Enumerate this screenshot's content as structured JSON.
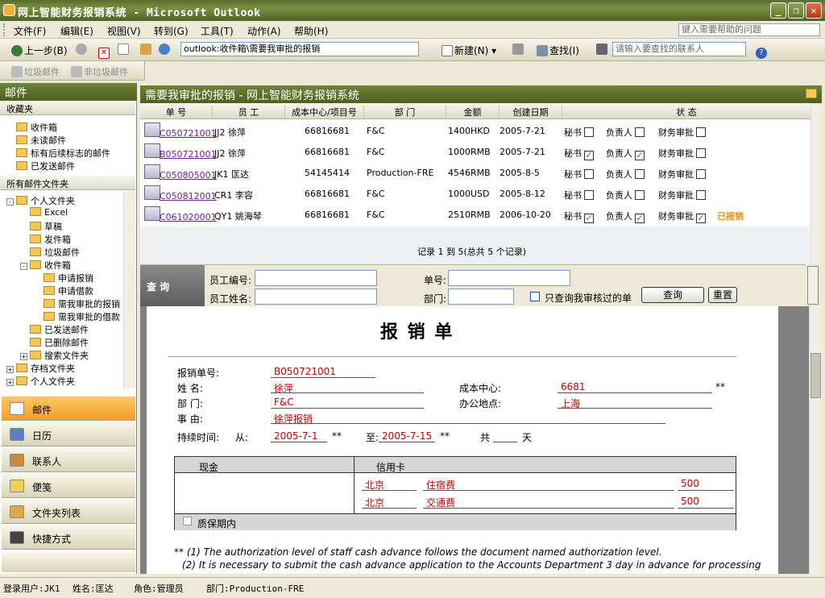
{
  "window": {
    "title": "网上智能财务报销系统 - Microsoft Outlook"
  },
  "menu": [
    "文件(F)",
    "编辑(E)",
    "视图(V)",
    "转到(G)",
    "工具(T)",
    "动作(A)",
    "帮助(H)"
  ],
  "help_placeholder": "键入需要帮助的问题",
  "toolbar": {
    "back": "上一步(B)",
    "address": "outlook:收件箱\\需要我审批的报销",
    "new": "新建(N)",
    "find": "查找(I)",
    "contact_placeholder": "请输入要查找的联系人"
  },
  "junkbar": {
    "junk": "垃圾邮件",
    "notjunk": "非垃圾邮件"
  },
  "left": {
    "header": "邮件",
    "favorites_title": "收藏夹",
    "favorites": [
      "收件箱",
      "未读邮件",
      "标有后续标志的邮件",
      "已发送邮件"
    ],
    "allfolders_title": "所有邮件文件夹",
    "tree": [
      {
        "label": "个人文件夹",
        "indent": 0,
        "exp": "-"
      },
      {
        "label": "Excel",
        "indent": 1
      },
      {
        "label": "草稿",
        "indent": 1
      },
      {
        "label": "发件箱",
        "indent": 1
      },
      {
        "label": "垃圾邮件",
        "indent": 1
      },
      {
        "label": "收件箱",
        "indent": 1,
        "exp": "-"
      },
      {
        "label": "申请报销",
        "indent": 2
      },
      {
        "label": "申请借款",
        "indent": 2
      },
      {
        "label": "需我审批的报销",
        "indent": 2
      },
      {
        "label": "需我审批的借款",
        "indent": 2
      },
      {
        "label": "已发送邮件",
        "indent": 1
      },
      {
        "label": "已删除邮件",
        "indent": 1
      },
      {
        "label": "搜索文件夹",
        "indent": 1,
        "exp": "+"
      },
      {
        "label": "存档文件夹",
        "indent": 0,
        "exp": "+"
      },
      {
        "label": "个人文件夹",
        "indent": 0,
        "exp": "+"
      }
    ],
    "nav": [
      "邮件",
      "日历",
      "联系人",
      "便笺",
      "文件夹列表",
      "快捷方式"
    ]
  },
  "main": {
    "header": "需要我审批的报销 - 网上智能财务报销系统",
    "columns": [
      "单 号",
      "员 工",
      "成本中心/项目号",
      "部 门",
      "金额",
      "创建日期",
      "状 态"
    ],
    "status_labels": {
      "secretary": "秘书",
      "manager": "负责人",
      "finance": "财务审批"
    },
    "rows": [
      {
        "id": "C050721001",
        "emp": "JJ2 徐萍",
        "cc": "66816681",
        "dept": "F&C",
        "amount": "1400HKD",
        "date": "2005-7-21",
        "s1": "",
        "s2": "",
        "s3": "",
        "extra": ""
      },
      {
        "id": "B050721001",
        "emp": "JJ2 徐萍",
        "cc": "66816681",
        "dept": "F&C",
        "amount": "1000RMB",
        "date": "2005-7-21",
        "s1": "✓",
        "s2": "✓",
        "s3": "",
        "extra": ""
      },
      {
        "id": "C050805001",
        "emp": "JK1 匡达",
        "cc": "54145414",
        "dept": "Production-FRE",
        "amount": "4546RMB",
        "date": "2005-8-5",
        "s1": "",
        "s2": "",
        "s3": "",
        "extra": ""
      },
      {
        "id": "C050812001",
        "emp": "CR1 李容",
        "cc": "66816681",
        "dept": "F&C",
        "amount": "1000USD",
        "date": "2005-8-12",
        "s1": "",
        "s2": "",
        "s3": "",
        "extra": ""
      },
      {
        "id": "C061020001",
        "emp": "QY1 姚海琴",
        "cc": "66816681",
        "dept": "F&C",
        "amount": "2510RMB",
        "date": "2006-10-20",
        "s1": "✓",
        "s2": "✓",
        "s3": "✓",
        "extra": "已报销"
      }
    ],
    "record_summary": "记录 1 到 5(总共 5 个记录)"
  },
  "query": {
    "label": "查 询",
    "emp_no": "员工编号:",
    "emp_name": "员工姓名:",
    "bill_no": "单号:",
    "dept": "部门:",
    "only_mine": "只查询我审核过的单",
    "search": "查询",
    "reset": "重置"
  },
  "doc": {
    "title": "报  销  单",
    "bill_no_label": "报销单号:",
    "bill_no": "B050721001",
    "name_label": "姓  名:",
    "name": "徐萍",
    "dept_label": "部  门:",
    "dept": "F&C",
    "reason_label": "事  由:",
    "reason": "徐萍报销",
    "cc_label": "成本中心:",
    "cc": "6681",
    "cc_mark": "**",
    "loc_label": "办公地点:",
    "loc": "上海",
    "dur_label": "持续时间:",
    "from_label": "从:",
    "from": "2005-7-1",
    "to_label": "至:",
    "to": "2005-7-15",
    "mark": "**",
    "total_label": "共",
    "days_label": "天",
    "cash": "现金",
    "credit": "信用卡",
    "lines": [
      {
        "city": "北京",
        "item": "住宿费",
        "amount": "500"
      },
      {
        "city": "北京",
        "item": "交通费",
        "amount": "500"
      }
    ],
    "warranty": "质保期内",
    "note1": "** (1) The authorization level of staff cash advance follows the document named authorization level.",
    "note2": "(2) It is necessary to submit the cash advance application to the Accounts Department 3 day in advance for processing"
  },
  "status": {
    "user": "登录用户:JK1",
    "name": "姓名:匡达",
    "role": "角色:管理员",
    "dept": "部门:Production-FRE"
  }
}
